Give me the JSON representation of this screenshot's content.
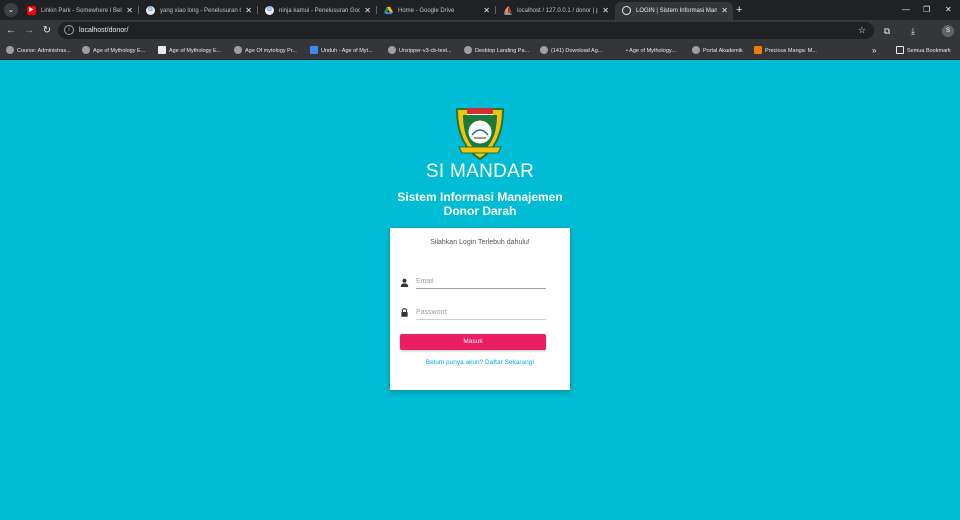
{
  "browser": {
    "tabs": [
      {
        "title": "Linkin Park - Somewhere I Belo",
        "favicon": "youtube-icon",
        "active": false
      },
      {
        "title": "yang xiao long - Penelusuran G",
        "favicon": "google-icon",
        "active": false
      },
      {
        "title": "ninja kamui - Penelusuran Goog",
        "favicon": "google-icon",
        "active": false
      },
      {
        "title": "Home - Google Drive",
        "favicon": "drive-icon",
        "active": false
      },
      {
        "title": "localhost / 127.0.0.1 / donor | p",
        "favicon": "phpmyadmin-icon",
        "active": false
      },
      {
        "title": "LOGIN | Sistem Informasi Mana",
        "favicon": "globe-icon",
        "active": true
      }
    ],
    "url": "localhost/donor/",
    "bookmarks": [
      {
        "label": "Course: Administras..."
      },
      {
        "label": "Age of Mythology E..."
      },
      {
        "label": "Age of Mythology E..."
      },
      {
        "label": "Age Of mytology Pr..."
      },
      {
        "label": "Unduh - Age of Myt..."
      },
      {
        "label": "Unzipper-v3-cb-test..."
      },
      {
        "label": "Desktop Landing Pa..."
      },
      {
        "label": "(141) Download Ag..."
      },
      {
        "label": "• Age of Mythology..."
      },
      {
        "label": "Portal Akademik"
      },
      {
        "label": "Precious Manga: M..."
      }
    ],
    "bookmarks_overflow": "»",
    "all_bookmarks": "Semua Bookmark",
    "profile_initial": "S"
  },
  "page": {
    "brand": "SI MANDAR",
    "subtitle_line1": "Sistem Informasi Manajemen",
    "subtitle_line2": "Donor Darah",
    "login": {
      "message": "Silahkan Login Terlebuh dahulu!",
      "email_placeholder": "Email",
      "password_placeholder": "Password",
      "submit_label": "Masuk",
      "register_link": "Belum punya akun? Daftar Sekarang!"
    }
  },
  "colors": {
    "page_background": "#00bcd4",
    "button": "#e91e63",
    "link": "#03a9f4",
    "card": "#ffffff"
  }
}
